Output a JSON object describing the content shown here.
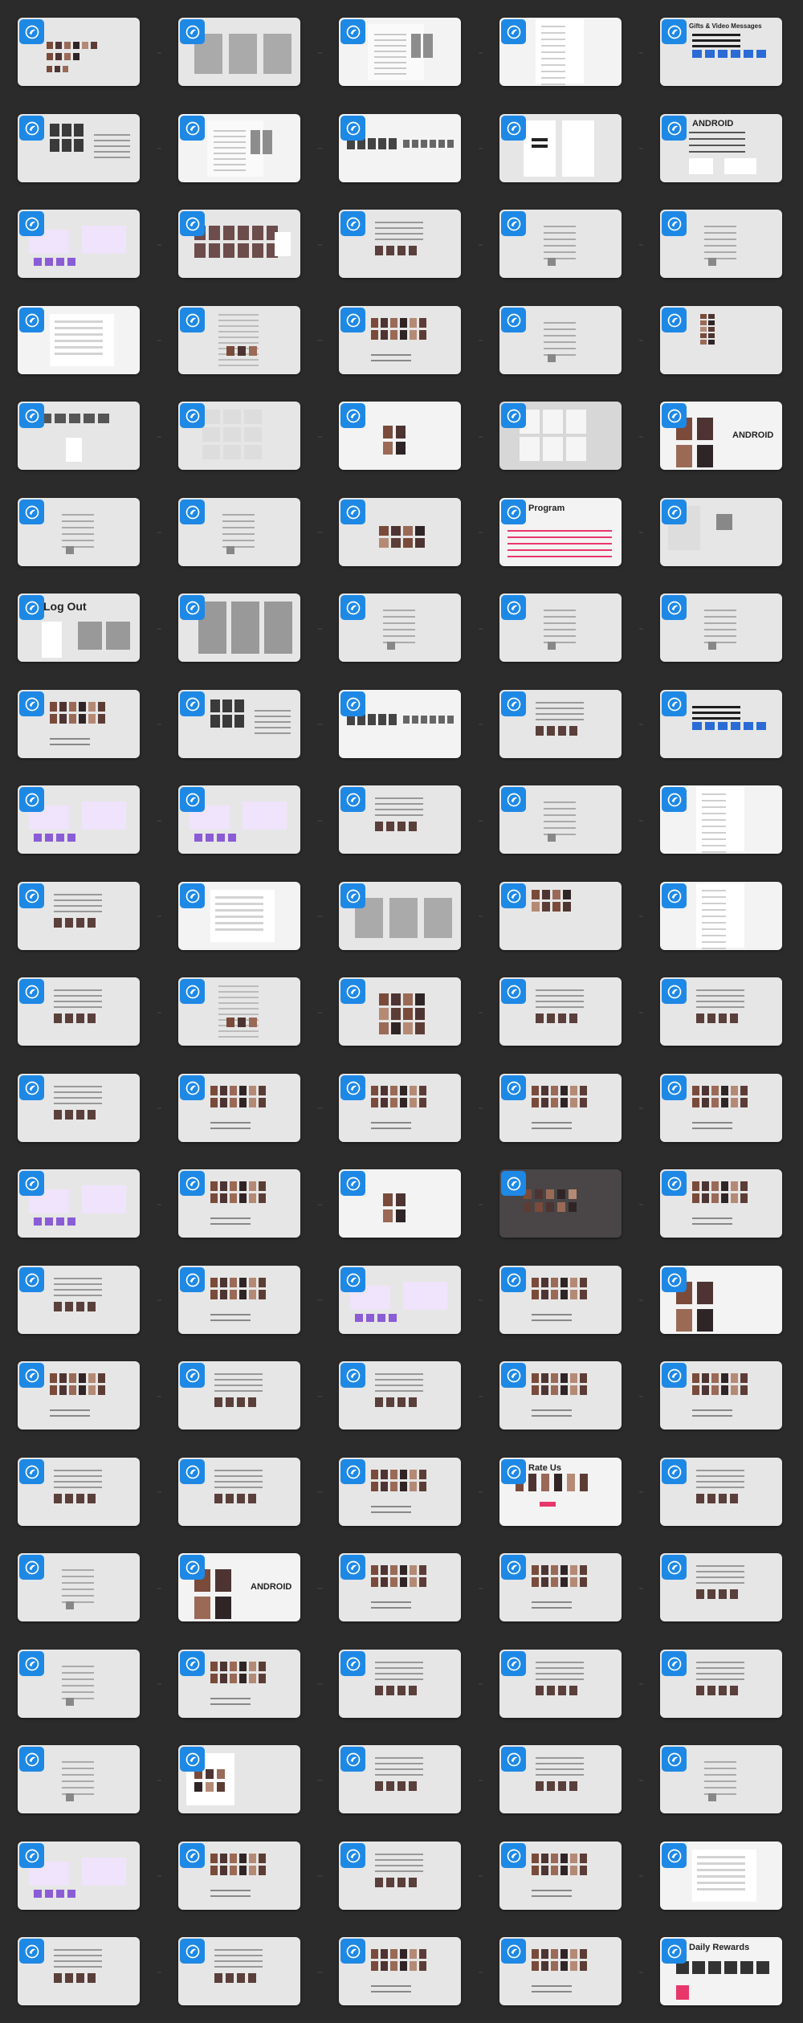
{
  "colors": {
    "background": "#2b2b2b",
    "card": "#e6e6e6",
    "card_alt": "#f3f3f3",
    "card_dark": "#4a4546",
    "badge": "#1e88e5",
    "accent_pink": "#e8376b",
    "accent_purple": "#8a5cd6",
    "accent_green": "#3ddc84"
  },
  "cards": [
    {
      "v": "a",
      "t": ""
    },
    {
      "v": "w",
      "t": ""
    },
    {
      "v": "b",
      "t": ""
    },
    {
      "v": "c",
      "t": ""
    },
    {
      "v": "d",
      "t": "Gifts & Video Messages"
    },
    {
      "v": "e",
      "t": ""
    },
    {
      "v": "b",
      "t": ""
    },
    {
      "v": "f",
      "t": ""
    },
    {
      "v": "g",
      "t": ""
    },
    {
      "v": "h",
      "t": "ANDROID"
    },
    {
      "v": "i",
      "t": ""
    },
    {
      "v": "j",
      "t": ""
    },
    {
      "v": "k",
      "t": ""
    },
    {
      "v": "l",
      "t": ""
    },
    {
      "v": "l",
      "t": ""
    },
    {
      "v": "m",
      "t": ""
    },
    {
      "v": "n",
      "t": ""
    },
    {
      "v": "o",
      "t": ""
    },
    {
      "v": "l",
      "t": ""
    },
    {
      "v": "p",
      "t": ""
    },
    {
      "v": "q",
      "t": ""
    },
    {
      "v": "r",
      "t": ""
    },
    {
      "v": "s",
      "t": ""
    },
    {
      "v": "t",
      "t": ""
    },
    {
      "v": "u",
      "t": "ANDROID"
    },
    {
      "v": "l",
      "t": ""
    },
    {
      "v": "l",
      "t": ""
    },
    {
      "v": "v",
      "t": ""
    },
    {
      "v": "x",
      "t": "Program"
    },
    {
      "v": "y",
      "t": ""
    },
    {
      "v": "z",
      "t": "Log Out"
    },
    {
      "v": "aa",
      "t": ""
    },
    {
      "v": "l",
      "t": ""
    },
    {
      "v": "l",
      "t": ""
    },
    {
      "v": "l",
      "t": ""
    },
    {
      "v": "o",
      "t": ""
    },
    {
      "v": "e",
      "t": ""
    },
    {
      "v": "f",
      "t": ""
    },
    {
      "v": "k",
      "t": ""
    },
    {
      "v": "d",
      "t": ""
    },
    {
      "v": "i",
      "t": ""
    },
    {
      "v": "i",
      "t": ""
    },
    {
      "v": "k",
      "t": ""
    },
    {
      "v": "l",
      "t": ""
    },
    {
      "v": "c",
      "t": ""
    },
    {
      "v": "k",
      "t": ""
    },
    {
      "v": "m",
      "t": ""
    },
    {
      "v": "w",
      "t": ""
    },
    {
      "v": "bb",
      "t": ""
    },
    {
      "v": "c",
      "t": ""
    },
    {
      "v": "k",
      "t": ""
    },
    {
      "v": "n",
      "t": ""
    },
    {
      "v": "cc",
      "t": ""
    },
    {
      "v": "k",
      "t": ""
    },
    {
      "v": "k",
      "t": ""
    },
    {
      "v": "k",
      "t": ""
    },
    {
      "v": "o",
      "t": ""
    },
    {
      "v": "o",
      "t": ""
    },
    {
      "v": "o",
      "t": ""
    },
    {
      "v": "o",
      "t": ""
    },
    {
      "v": "i",
      "t": ""
    },
    {
      "v": "o",
      "t": ""
    },
    {
      "v": "s",
      "t": ""
    },
    {
      "v": "dd",
      "t": ""
    },
    {
      "v": "o",
      "t": ""
    },
    {
      "v": "k",
      "t": ""
    },
    {
      "v": "o",
      "t": ""
    },
    {
      "v": "i",
      "t": ""
    },
    {
      "v": "o",
      "t": ""
    },
    {
      "v": "u",
      "t": ""
    },
    {
      "v": "o",
      "t": ""
    },
    {
      "v": "k",
      "t": ""
    },
    {
      "v": "k",
      "t": ""
    },
    {
      "v": "o",
      "t": ""
    },
    {
      "v": "o",
      "t": ""
    },
    {
      "v": "k",
      "t": ""
    },
    {
      "v": "k",
      "t": ""
    },
    {
      "v": "o",
      "t": ""
    },
    {
      "v": "ee",
      "t": "Rate Us"
    },
    {
      "v": "k",
      "t": ""
    },
    {
      "v": "l",
      "t": ""
    },
    {
      "v": "u",
      "t": "ANDROID"
    },
    {
      "v": "o",
      "t": ""
    },
    {
      "v": "o",
      "t": ""
    },
    {
      "v": "k",
      "t": ""
    },
    {
      "v": "l",
      "t": ""
    },
    {
      "v": "o",
      "t": ""
    },
    {
      "v": "k",
      "t": ""
    },
    {
      "v": "k",
      "t": ""
    },
    {
      "v": "k",
      "t": ""
    },
    {
      "v": "l",
      "t": ""
    },
    {
      "v": "ff",
      "t": ""
    },
    {
      "v": "k",
      "t": ""
    },
    {
      "v": "k",
      "t": ""
    },
    {
      "v": "l",
      "t": ""
    },
    {
      "v": "i",
      "t": ""
    },
    {
      "v": "o",
      "t": ""
    },
    {
      "v": "k",
      "t": ""
    },
    {
      "v": "o",
      "t": ""
    },
    {
      "v": "m",
      "t": ""
    },
    {
      "v": "k",
      "t": ""
    },
    {
      "v": "k",
      "t": ""
    },
    {
      "v": "o",
      "t": ""
    },
    {
      "v": "o",
      "t": ""
    },
    {
      "v": "gg",
      "t": "Daily Rewards"
    }
  ]
}
